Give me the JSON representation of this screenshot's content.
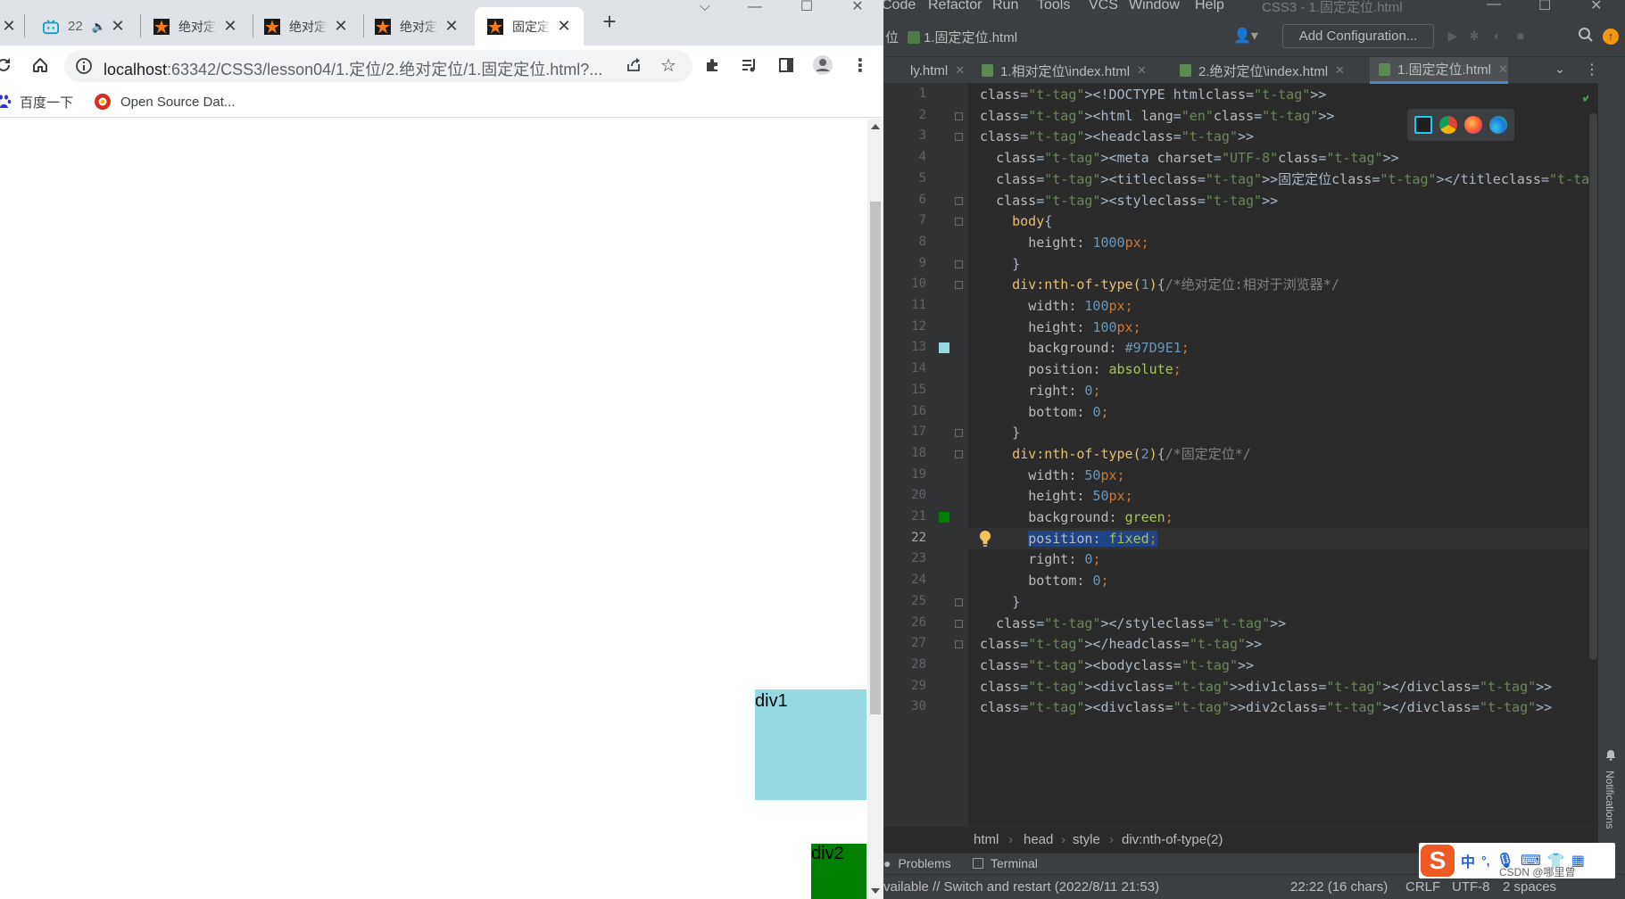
{
  "browser": {
    "tabs": [
      {
        "title": "",
        "kind": "partial"
      },
      {
        "title": "22",
        "kind": "bilibili",
        "muted": true
      },
      {
        "title": "绝对定位",
        "kind": "webstorm"
      },
      {
        "title": "绝对定位",
        "kind": "webstorm"
      },
      {
        "title": "绝对定位",
        "kind": "webstorm"
      },
      {
        "title": "固定定位",
        "kind": "webstorm",
        "active": true
      }
    ],
    "new_tab_label": "+",
    "url_host": "localhost",
    "url_path": ":63342/CSS3/lesson04/1.定位/2.绝对定位/1.固定定位.html?...",
    "bookmarks": [
      {
        "label": "百度一下",
        "icon": "baidu-icon"
      },
      {
        "label": "Open Source Dat...",
        "icon": "opensource-icon"
      }
    ],
    "page": {
      "div1_text": "div1",
      "div2_text": "div2",
      "div1_color": "#97D9E1",
      "div2_color": "green"
    }
  },
  "ide": {
    "menu": [
      "Code",
      "Refactor",
      "Run",
      "Tools",
      "VCS",
      "Window",
      "Help"
    ],
    "window_title": "CSS3 - 1.固定定位.html",
    "nav_prefix": "位",
    "nav_file": "1.固定定位.html",
    "add_configuration": "Add Configuration...",
    "editor_tabs": [
      {
        "label": "ly.html",
        "active": false
      },
      {
        "label": "1.相对定位\\index.html",
        "active": false
      },
      {
        "label": "2.绝对定位\\index.html",
        "active": false
      },
      {
        "label": "1.固定定位.html",
        "active": true
      }
    ],
    "code_lines": [
      "<!DOCTYPE html>",
      "<html lang=\"en\">",
      "<head>",
      "  <meta charset=\"UTF-8\">",
      "  <title>固定定位</title>",
      "  <style>",
      "    body{",
      "      height: 1000px;",
      "    }",
      "    div:nth-of-type(1){/*绝对定位:相对于浏览器*/",
      "      width: 100px;",
      "      height: 100px;",
      "      background: #97D9E1;",
      "      position: absolute;",
      "      right: 0;",
      "      bottom: 0;",
      "    }",
      "    div:nth-of-type(2){/*固定定位*/",
      "      width: 50px;",
      "      height: 50px;",
      "      background: green;",
      "      position: fixed;",
      "      right: 0;",
      "      bottom: 0;",
      "    }",
      "  </style>",
      "</head>",
      "<body>",
      "<div>div1</div>",
      "<div>div2</div>"
    ],
    "current_line": 22,
    "breadcrumbs": [
      "html",
      "head",
      "style",
      "div:nth-of-type(2)"
    ],
    "toolwindows": [
      "Problems",
      "Terminal"
    ],
    "status_left": "vailable // Switch and restart (2022/8/11 21:53)",
    "status_pos": "22:22 (16 chars)",
    "status_crlf": "CRLF",
    "status_enc": "UTF-8",
    "status_indent": "2 spaces",
    "notifications_label": "Notifications",
    "ime_label": "中",
    "watermark": "CSDN @哪里曾"
  }
}
